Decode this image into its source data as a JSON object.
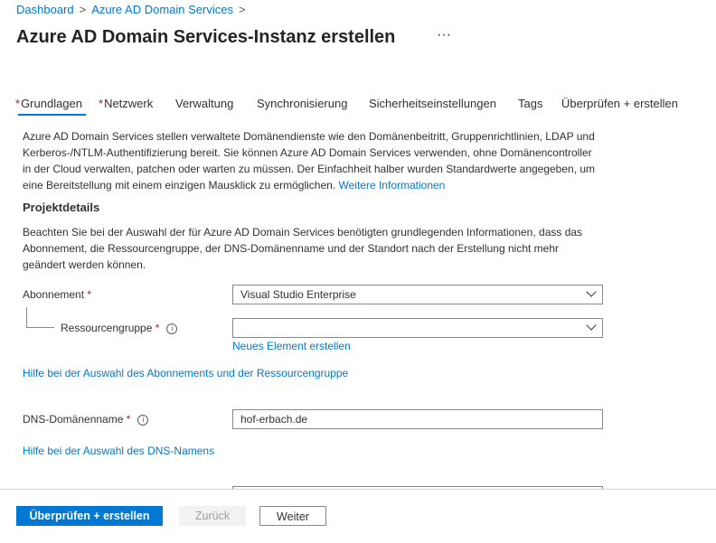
{
  "breadcrumb": {
    "items": [
      "Dashboard",
      "Azure AD Domain Services"
    ]
  },
  "header": {
    "title": "Azure AD Domain Services-Instanz erstellen",
    "more": "···"
  },
  "tabs": [
    {
      "label": "Grundlagen",
      "required": true,
      "active": true
    },
    {
      "label": "Netzwerk",
      "required": true
    },
    {
      "label": "Verwaltung"
    },
    {
      "label": "Synchronisierung"
    },
    {
      "label": "Sicherheitseinstellungen"
    },
    {
      "label": "Tags"
    },
    {
      "label": "Überprüfen + erstellen"
    }
  ],
  "intro": {
    "text": "Azure AD Domain Services stellen verwaltete Domänendienste wie den Domänenbeitritt, Gruppenrichtlinien, LDAP und Kerberos-/NTLM-Authentifizierung bereit. Sie können Azure AD Domain Services verwenden, ohne Domänencontroller in der Cloud verwalten, patchen oder warten zu müssen. Der Einfachheit halber wurden Standardwerte angegeben, um eine Bereitstellung mit einem einzigen Mausklick zu ermöglichen.",
    "link": "Weitere Informationen"
  },
  "project": {
    "heading": "Projektdetails",
    "text": "Beachten Sie bei der Auswahl der für Azure AD Domain Services benötigten grundlegenden Informationen, dass das Abonnement, die Ressourcengruppe, der DNS-Domänenname und der Standort nach der Erstellung nicht mehr geändert werden können."
  },
  "form": {
    "subscription": {
      "label": "Abonnement",
      "required": "*",
      "value": "Visual Studio Enterprise"
    },
    "resource_group": {
      "label": "Ressourcengruppe",
      "required": "*",
      "value": "",
      "create_link": "Neues Element erstellen"
    },
    "help_subscription": "Hilfe bei der Auswahl des Abonnements und der Ressourcengruppe",
    "dns": {
      "label": "DNS-Domänenname",
      "required": "*",
      "value": "hof-erbach.de"
    },
    "help_dns": "Hilfe bei der Auswahl des DNS-Namens"
  },
  "footer": {
    "review": "Überprüfen + erstellen",
    "back": "Zurück",
    "next": "Weiter"
  },
  "colors": {
    "accent": "#0078d4",
    "required": "#a4262c"
  }
}
